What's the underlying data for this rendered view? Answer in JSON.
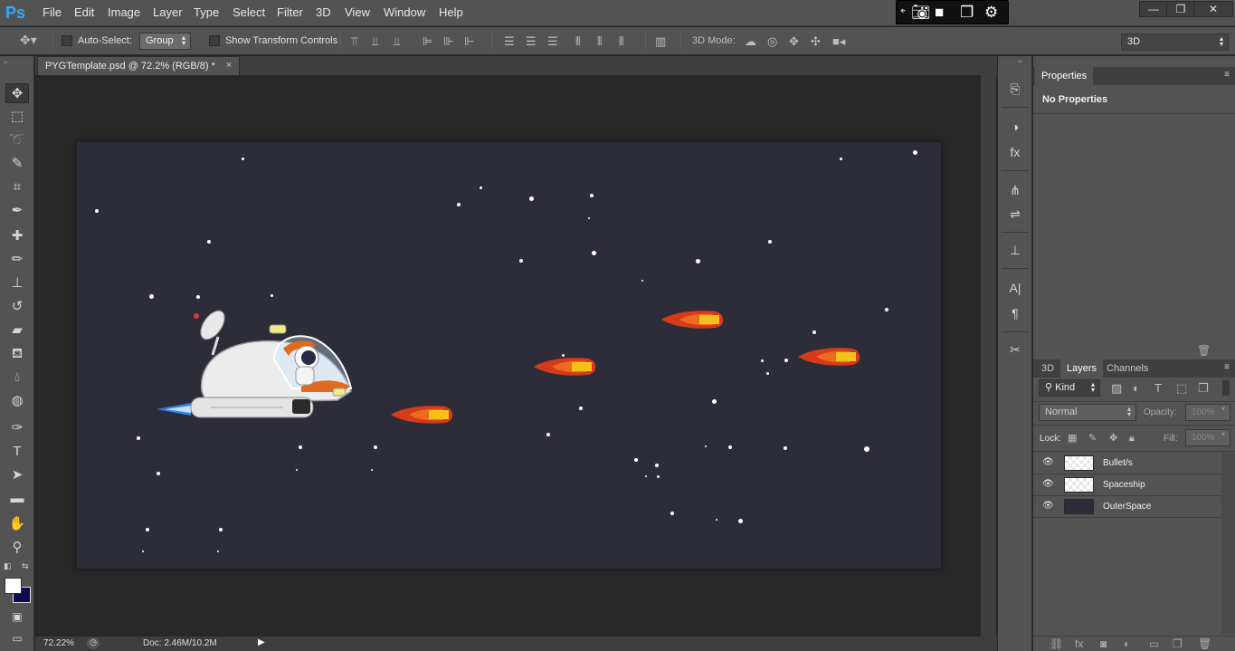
{
  "app": {
    "logo": "Ps"
  },
  "menu": [
    "File",
    "Edit",
    "Image",
    "Layer",
    "Type",
    "Select",
    "Filter",
    "3D",
    "View",
    "Window",
    "Help"
  ],
  "window_controls": [
    "—",
    "❐",
    "✕"
  ],
  "options": {
    "auto_select_label": "Auto-Select:",
    "auto_select_value": "Group",
    "show_transform_label": "Show Transform Controls",
    "mode_3d_label": "3D Mode:",
    "workspace_value": "3D"
  },
  "document": {
    "tab_title": "PYGTemplate.psd @ 72.2% (RGB/8) *",
    "tab_close": "×",
    "zoom": "72.22%",
    "doc_size": "Doc: 2.46M/10.2M"
  },
  "properties": {
    "tab": "Properties",
    "content": "No Properties"
  },
  "layers_panel": {
    "tabs": [
      "3D",
      "Layers",
      "Channels"
    ],
    "active_tab": "Layers",
    "filter_kind": "Kind",
    "blend_mode": "Normal",
    "opacity_label": "Opacity:",
    "opacity_value": "100%",
    "lock_label": "Lock:",
    "fill_label": "Fill:",
    "fill_value": "100%",
    "layers": [
      {
        "name": "Bullet/s",
        "visible": true
      },
      {
        "name": "Spaceship",
        "visible": true
      },
      {
        "name": "OuterSpace",
        "visible": true
      }
    ]
  },
  "colors": {
    "space_bg": "#2d2c39",
    "foreground": "#ffffff",
    "background": "#0b0950",
    "bullet_outer": "#d63a1a",
    "bullet_core": "#f2c21b"
  },
  "icons": {
    "tools": [
      "move-icon",
      "marquee-icon",
      "lasso-icon",
      "quick-select-icon",
      "crop-icon",
      "eyedropper-icon",
      "healing-icon",
      "brush-icon",
      "stamp-icon",
      "history-brush-icon",
      "eraser-icon",
      "paint-bucket-icon",
      "blur-icon",
      "dodge-icon",
      "pen-icon",
      "type-icon",
      "path-select-icon",
      "rectangle-icon",
      "hand-icon",
      "zoom-icon"
    ]
  }
}
